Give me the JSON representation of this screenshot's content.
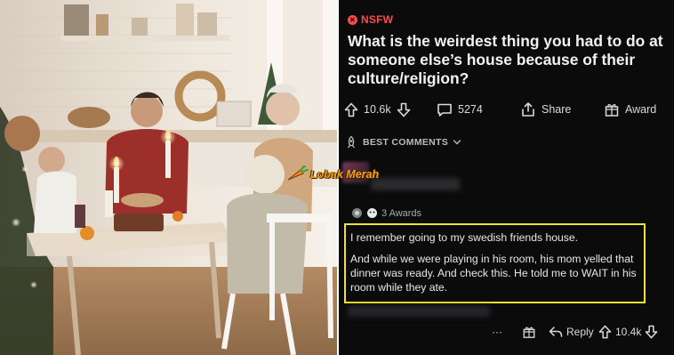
{
  "post": {
    "nsfw_label": "NSFW",
    "title": "What is the weirdest thing you had to do at someone else’s house because of their culture/religion?",
    "votes": "10.6k",
    "comments_count": "5274",
    "share_label": "Share",
    "award_label": "Award"
  },
  "comments_header": {
    "label": "BEST COMMENTS"
  },
  "comment": {
    "awards_label": "3 Awards",
    "paragraphs": [
      "I remember going to my swedish friends house.",
      "And while we were playing in his room, his mom yelled that dinner was ready. And check this. He told me to WAIT in his room while they ate."
    ],
    "more_glyph": "···",
    "reply_label": "Reply",
    "votes": "10.4k"
  },
  "watermark": {
    "text": "Lobak Merah"
  },
  "colors": {
    "nsfw": "#ff4a4a",
    "highlight_border": "#f0e32a",
    "panel_bg": "#0b0b0c",
    "watermark": "#f5a21a"
  },
  "icons": [
    "nsfw-icon",
    "upvote-icon",
    "downvote-icon",
    "comment-icon",
    "share-icon",
    "award-icon",
    "rocket-icon",
    "chevron-down-icon",
    "more-icon",
    "reply-icon"
  ]
}
